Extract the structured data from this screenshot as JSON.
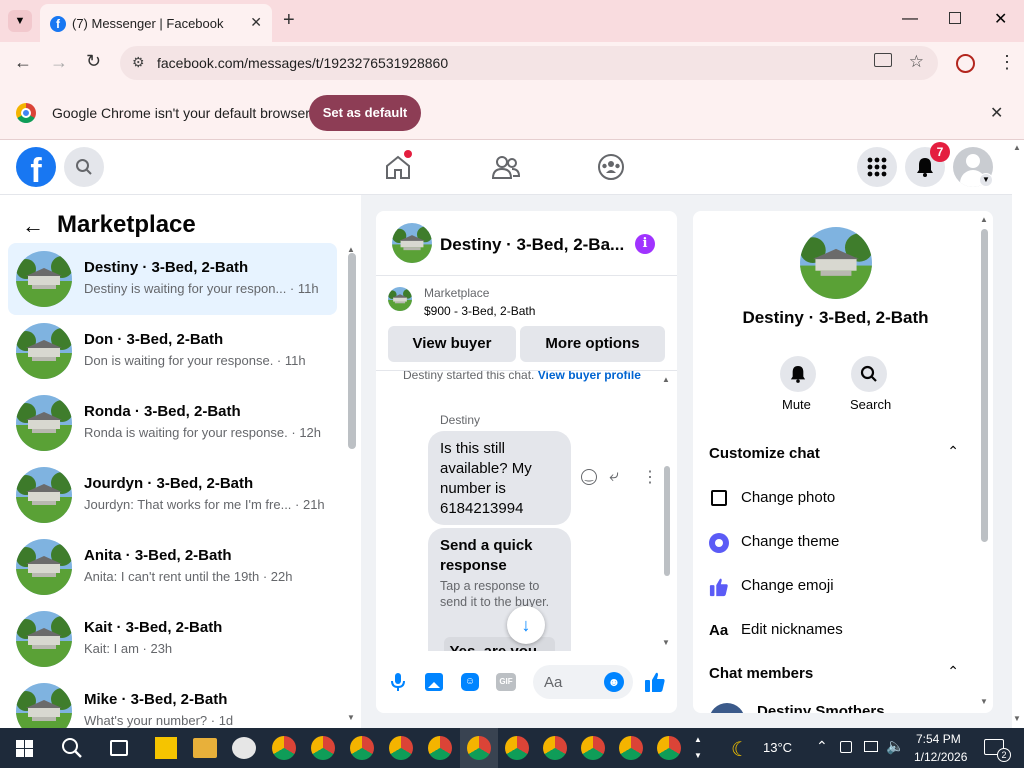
{
  "browser": {
    "tab_title": "(7) Messenger | Facebook",
    "url": "facebook.com/messages/t/1923276531928860",
    "infobar_message": "Google Chrome isn't your default browser",
    "set_default_label": "Set as default"
  },
  "fb": {
    "notifications_count": "7"
  },
  "sidebar": {
    "title": "Marketplace",
    "conversations": [
      {
        "name": "Destiny · 3-Bed, 2-Bath",
        "preview": "Destiny is waiting for your respon... · 11h"
      },
      {
        "name": "Don · 3-Bed, 2-Bath",
        "preview": "Don is waiting for your response. · 11h"
      },
      {
        "name": "Ronda · 3-Bed, 2-Bath",
        "preview": "Ronda is waiting for your response. · 12h"
      },
      {
        "name": "Jourdyn · 3-Bed, 2-Bath",
        "preview": "Jourdyn: That works for me I'm fre... · 21h"
      },
      {
        "name": "Anita · 3-Bed, 2-Bath",
        "preview": "Anita: I can't rent until the 19th · 22h"
      },
      {
        "name": "Kait · 3-Bed, 2-Bath",
        "preview": "Kait: I am · 23h"
      },
      {
        "name": "Mike · 3-Bed, 2-Bath",
        "preview": "What's your number? · 1d"
      }
    ]
  },
  "chat": {
    "header_name": "Destiny · 3-Bed, 2-Ba...",
    "listing_label": "Marketplace",
    "listing_price": "$900 - 3-Bed, 2-Bath",
    "view_buyer": "View buyer",
    "more_options": "More options",
    "started_text": "Destiny started this chat.",
    "view_buyer_profile": "View buyer profile",
    "sender": "Destiny",
    "message": "Is this still available? My number is 6184213994",
    "quick_title": "Send a quick response",
    "quick_sub": "Tap a response to send it to the buyer.",
    "quick_option": "Yes, are you...",
    "composer_placeholder": "Aa"
  },
  "details": {
    "name": "Destiny · 3-Bed, 2-Bath",
    "mute": "Mute",
    "search": "Search",
    "customize": "Customize chat",
    "change_photo": "Change photo",
    "change_theme": "Change theme",
    "change_emoji": "Change emoji",
    "edit_nicknames": "Edit nicknames",
    "chat_members": "Chat members",
    "member_name": "Destiny Smothers"
  },
  "taskbar": {
    "weather": "13°C",
    "time": "7:54 PM",
    "date": "1/12/2026",
    "notif_count": "2"
  },
  "colors": {
    "fb_blue": "#1877f2",
    "messenger_purple": "#a033ff",
    "notification_red": "#e41e3f",
    "chrome_button": "#8d3d55"
  }
}
